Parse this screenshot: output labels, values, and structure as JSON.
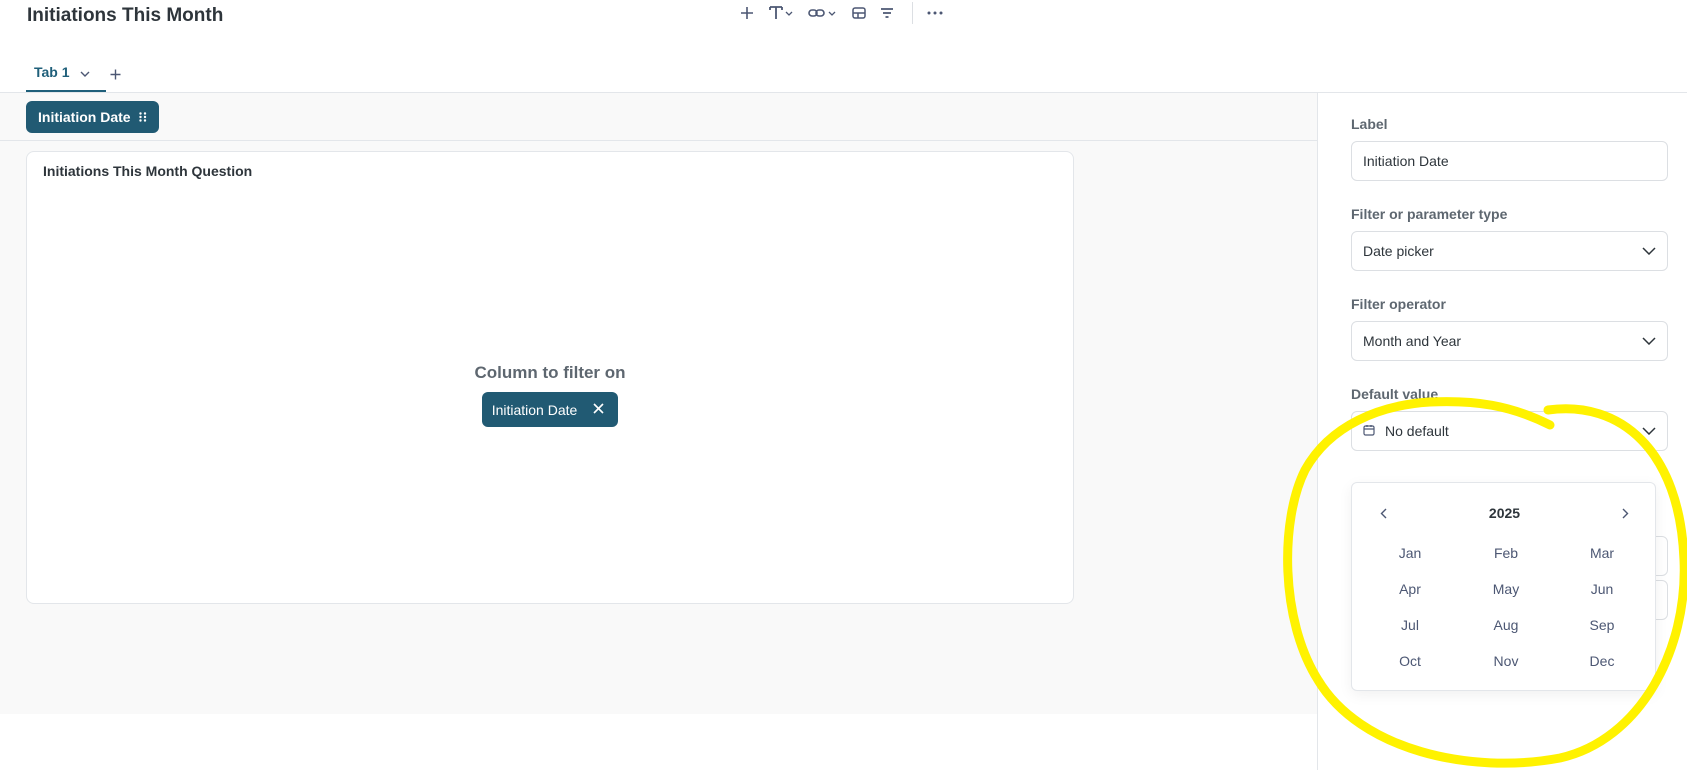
{
  "header": {
    "title": "Initiations This Month"
  },
  "toolbar": {
    "icons": [
      "add-icon",
      "text-icon",
      "link-icon",
      "section-icon",
      "filter-icon",
      "more-icon"
    ]
  },
  "tabs": [
    {
      "label": "Tab 1"
    }
  ],
  "filter_bar": {
    "chip_label": "Initiation Date"
  },
  "card": {
    "title": "Initiations This Month Question",
    "column_filter_title": "Column to filter on",
    "column_chip_label": "Initiation Date"
  },
  "sidebar": {
    "label_field": {
      "label": "Label",
      "value": "Initiation Date"
    },
    "type_field": {
      "label": "Filter or parameter type",
      "value": "Date picker"
    },
    "operator_field": {
      "label": "Filter operator",
      "value": "Month and Year"
    },
    "default_field": {
      "label": "Default value",
      "value": "No default"
    }
  },
  "picker": {
    "year": "2025",
    "months": [
      "Jan",
      "Feb",
      "Mar",
      "Apr",
      "May",
      "Jun",
      "Jul",
      "Aug",
      "Sep",
      "Oct",
      "Nov",
      "Dec"
    ]
  },
  "colors": {
    "brand": "#215a73",
    "annotation": "#fff200"
  }
}
